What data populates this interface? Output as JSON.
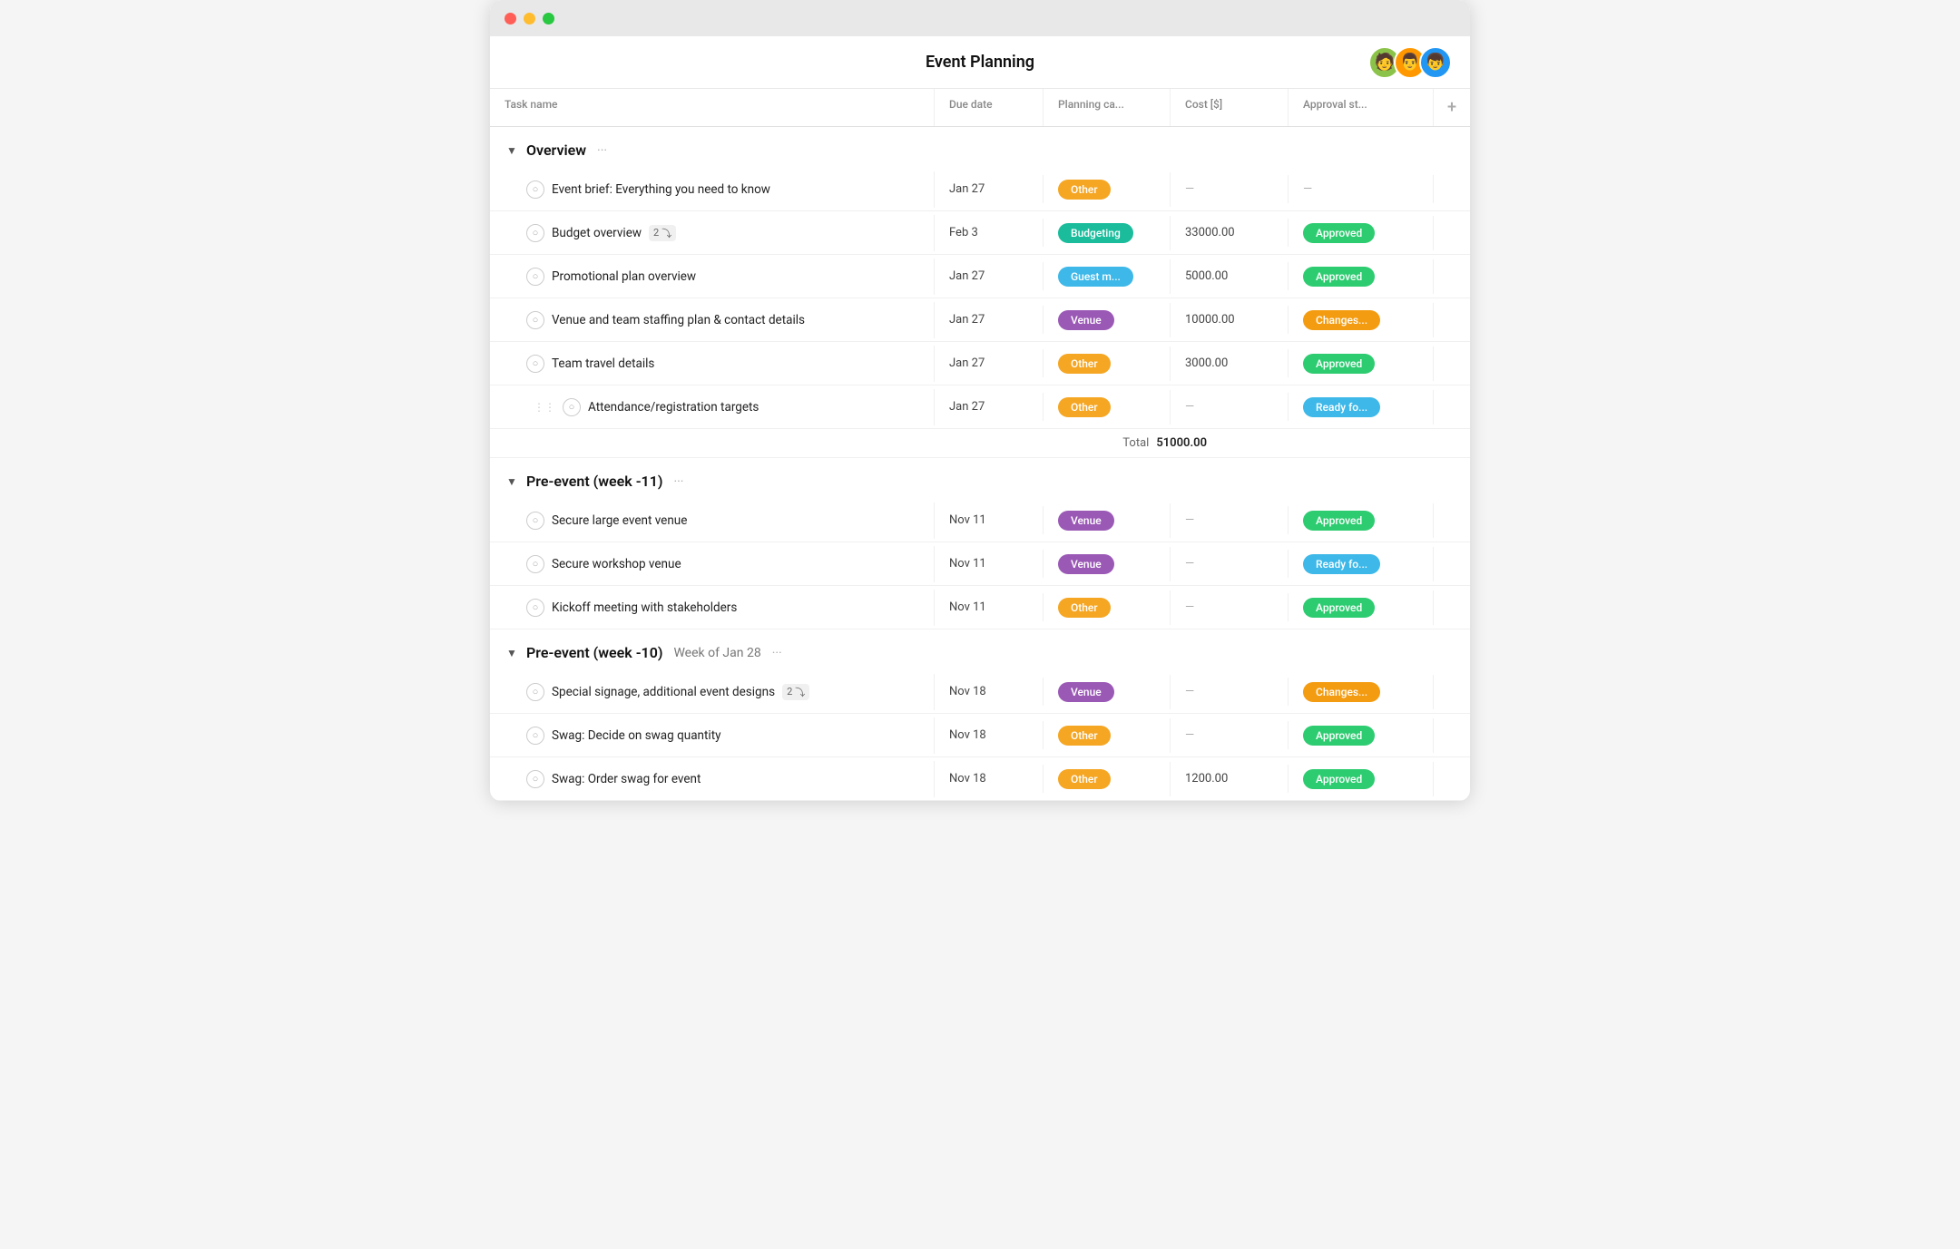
{
  "window": {
    "title": "Event Planning"
  },
  "header": {
    "title": "Event Planning"
  },
  "avatars": [
    {
      "id": "avatar-1",
      "color": "#8bc34a",
      "initial": "👩"
    },
    {
      "id": "avatar-2",
      "color": "#ff9800",
      "initial": "👨"
    },
    {
      "id": "avatar-3",
      "color": "#2196f3",
      "initial": "👦"
    }
  ],
  "columns": [
    {
      "id": "task-name",
      "label": "Task name"
    },
    {
      "id": "due-date",
      "label": "Due date"
    },
    {
      "id": "planning-cat",
      "label": "Planning ca..."
    },
    {
      "id": "cost",
      "label": "Cost [$]"
    },
    {
      "id": "approval-st",
      "label": "Approval st..."
    },
    {
      "id": "add",
      "label": "+"
    }
  ],
  "sections": [
    {
      "id": "overview",
      "title": "Overview",
      "subtitle": "",
      "dots": "···",
      "collapsed": false,
      "tasks": [
        {
          "id": "task-1",
          "name": "Event brief: Everything you need to know",
          "due_date": "Jan 27",
          "category": "Other",
          "category_color": "orange",
          "cost": "—",
          "approval": "—",
          "approval_color": "",
          "subtasks": 0
        },
        {
          "id": "task-2",
          "name": "Budget overview",
          "due_date": "Feb 3",
          "category": "Budgeting",
          "category_color": "teal",
          "cost": "33000.00",
          "approval": "Approved",
          "approval_color": "green",
          "subtasks": 2
        },
        {
          "id": "task-3",
          "name": "Promotional plan overview",
          "due_date": "Jan 27",
          "category": "Guest m...",
          "category_color": "blue",
          "cost": "5000.00",
          "approval": "Approved",
          "approval_color": "green",
          "subtasks": 0
        },
        {
          "id": "task-4",
          "name": "Venue and team staffing plan & contact details",
          "due_date": "Jan 27",
          "category": "Venue",
          "category_color": "purple",
          "cost": "10000.00",
          "approval": "Changes...",
          "approval_color": "yellow-orange",
          "subtasks": 0
        },
        {
          "id": "task-5",
          "name": "Team travel details",
          "due_date": "Jan 27",
          "category": "Other",
          "category_color": "orange",
          "cost": "3000.00",
          "approval": "Approved",
          "approval_color": "green",
          "subtasks": 0
        },
        {
          "id": "task-6",
          "name": "Attendance/registration targets",
          "due_date": "Jan 27",
          "category": "Other",
          "category_color": "orange",
          "cost": "—",
          "approval": "Ready fo...",
          "approval_color": "blue",
          "subtasks": 0,
          "drag": true
        }
      ],
      "total": "51000.00"
    },
    {
      "id": "pre-event-11",
      "title": "Pre-event (week -11)",
      "subtitle": "",
      "dots": "···",
      "collapsed": false,
      "tasks": [
        {
          "id": "task-7",
          "name": "Secure large event venue",
          "due_date": "Nov 11",
          "category": "Venue",
          "category_color": "purple",
          "cost": "—",
          "approval": "Approved",
          "approval_color": "green",
          "subtasks": 0
        },
        {
          "id": "task-8",
          "name": "Secure workshop venue",
          "due_date": "Nov 11",
          "category": "Venue",
          "category_color": "purple",
          "cost": "—",
          "approval": "Ready fo...",
          "approval_color": "blue",
          "subtasks": 0
        },
        {
          "id": "task-9",
          "name": "Kickoff meeting with stakeholders",
          "due_date": "Nov 11",
          "category": "Other",
          "category_color": "orange",
          "cost": "—",
          "approval": "Approved",
          "approval_color": "green",
          "subtasks": 0
        }
      ],
      "total": null
    },
    {
      "id": "pre-event-10",
      "title": "Pre-event (week -10)",
      "subtitle": "Week of Jan 28",
      "dots": "···",
      "collapsed": false,
      "tasks": [
        {
          "id": "task-10",
          "name": "Special signage, additional event designs",
          "due_date": "Nov 18",
          "category": "Venue",
          "category_color": "purple",
          "cost": "—",
          "approval": "Changes...",
          "approval_color": "yellow-orange",
          "subtasks": 2
        },
        {
          "id": "task-11",
          "name": "Swag: Decide on swag quantity",
          "due_date": "Nov 18",
          "category": "Other",
          "category_color": "orange",
          "cost": "—",
          "approval": "Approved",
          "approval_color": "green",
          "subtasks": 0
        },
        {
          "id": "task-12",
          "name": "Swag: Order swag for event",
          "due_date": "Nov 18",
          "category": "Other",
          "category_color": "orange",
          "cost": "1200.00",
          "approval": "Approved",
          "approval_color": "green",
          "subtasks": 0
        }
      ],
      "total": null
    }
  ],
  "labels": {
    "total": "Total",
    "add_column": "+",
    "subtask_icon": "⤵"
  }
}
